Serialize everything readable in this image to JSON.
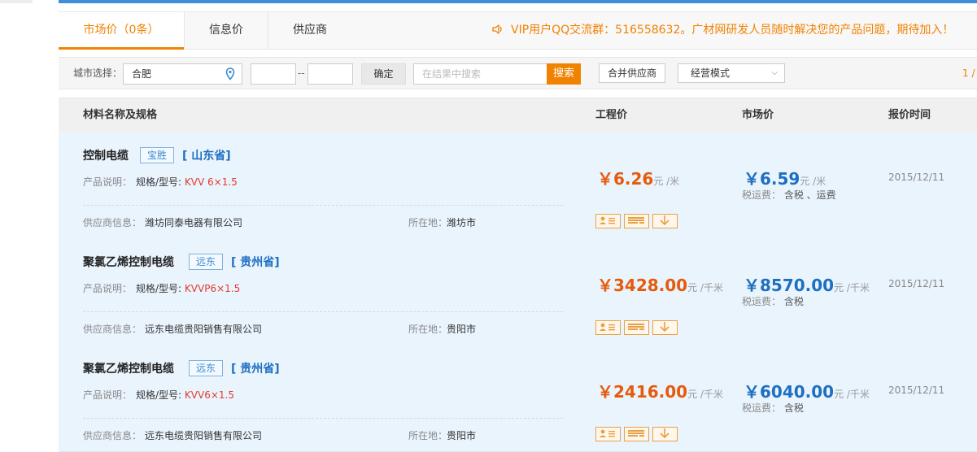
{
  "tabs": [
    {
      "label": "市场价（0条）",
      "active": true
    },
    {
      "label": "信息价",
      "active": false
    },
    {
      "label": "供应商",
      "active": false
    }
  ],
  "notice": "VIP用户QQ交流群：516558632。广材网研发人员随时解决您的产品问题，期待加入！",
  "filter": {
    "city_label": "城市选择：",
    "city_value": "合肥",
    "range_dash": "--",
    "confirm_label": "确定",
    "search_placeholder": "在结果中搜索",
    "search_label": "搜索",
    "merge_label": "合并供应商",
    "mode_label": "经营模式",
    "pager": "1 /"
  },
  "table": {
    "headers": [
      "材料名称及规格",
      "工程价",
      "市场价",
      "报价时间"
    ],
    "labels": {
      "desc": "产品说明：",
      "spec_prefix": "规格/型号:",
      "supplier": "供应商信息：",
      "location": "所在地：",
      "tax": "税运费："
    },
    "rows": [
      {
        "name": "控制电缆",
        "brand": "宝胜",
        "province": "[ 山东省]",
        "spec": "KVV 6×1.5",
        "supplier": "潍坊同泰电器有限公司",
        "location": "潍坊市",
        "eng_price": "￥6.26",
        "eng_unit": "元 /米",
        "mkt_price": "￥6.59",
        "mkt_unit": "元 /米",
        "tax": "含税 、运费",
        "date": "2015/12/11"
      },
      {
        "name": "聚氯乙烯控制电缆",
        "brand": "远东",
        "province": "[ 贵州省]",
        "spec": "KVVP6×1.5",
        "supplier": "远东电缆贵阳销售有限公司",
        "location": "贵阳市",
        "eng_price": "￥3428.00",
        "eng_unit": "元 /千米",
        "mkt_price": "￥8570.00",
        "mkt_unit": "元 /千米",
        "tax": "含税",
        "date": "2015/12/11"
      },
      {
        "name": "聚氯乙烯控制电缆",
        "brand": "远东",
        "province": "[ 贵州省]",
        "spec": "KVV6×1.5",
        "supplier": "远东电缆贵阳销售有限公司",
        "location": "贵阳市",
        "eng_price": "￥2416.00",
        "eng_unit": "元 /千米",
        "mkt_price": "￥6040.00",
        "mkt_unit": "元 /千米",
        "tax": "含税",
        "date": "2015/12/11"
      }
    ]
  },
  "colors": {
    "accent": "#f08200",
    "link_blue": "#1e6fc1",
    "row_bg": "#eaf4fd",
    "top_bar": "#3f8fd8"
  },
  "icons": [
    "speaker-icon",
    "location-pin-icon",
    "supplier-card-icon",
    "keyboard-icon",
    "download-icon"
  ]
}
